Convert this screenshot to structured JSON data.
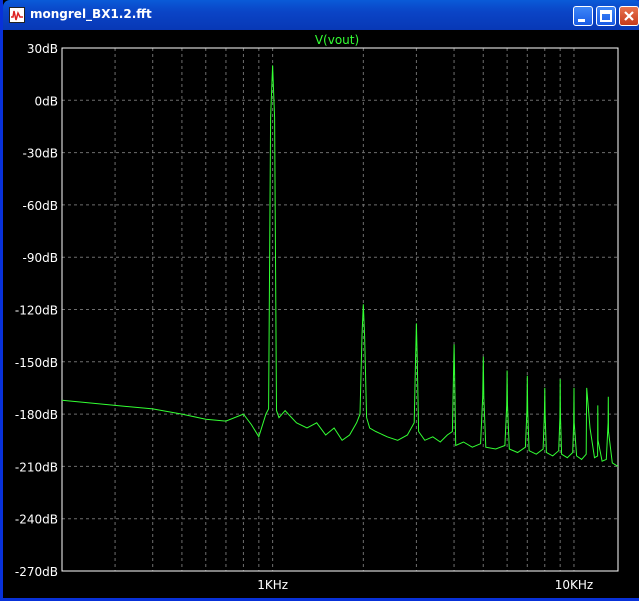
{
  "window": {
    "title": "mongrel_BX1.2.fft",
    "buttons": [
      "minimize",
      "maximize",
      "close"
    ],
    "icon": "waveform-icon"
  },
  "plot": {
    "trace_label": "V(vout)",
    "colors": {
      "background": "#000000",
      "trace": "#33ff33",
      "grid": "#6e6e6e",
      "axis_text": "#ffffff",
      "title_bar": "#0a44c6"
    }
  },
  "chart_data": {
    "type": "line",
    "title": "V(vout)",
    "xlabel": "",
    "ylabel": "",
    "x_scale": "log",
    "xlim_hz": [
      200,
      14000
    ],
    "ylim": [
      -270,
      30
    ],
    "y_ticks": [
      "30dB",
      "0dB",
      "-30dB",
      "-60dB",
      "-90dB",
      "-120dB",
      "-150dB",
      "-180dB",
      "-210dB",
      "-240dB",
      "-270dB"
    ],
    "x_ticks": [
      "1KHz",
      "10KHz"
    ],
    "grid": true,
    "series": [
      {
        "name": "V(vout)",
        "x_hz": [
          200,
          300,
          400,
          500,
          600,
          700,
          800,
          850,
          900,
          950,
          970,
          985,
          1000,
          1015,
          1030,
          1050,
          1100,
          1200,
          1300,
          1400,
          1500,
          1600,
          1700,
          1800,
          1900,
          1950,
          1980,
          2000,
          2020,
          2050,
          2100,
          2200,
          2400,
          2600,
          2800,
          2950,
          2980,
          3000,
          3020,
          3050,
          3200,
          3400,
          3600,
          3800,
          3950,
          3980,
          4000,
          4020,
          4050,
          4300,
          4600,
          4900,
          4980,
          5000,
          5020,
          5100,
          5500,
          5900,
          5980,
          6000,
          6020,
          6100,
          6500,
          6900,
          6980,
          7000,
          7020,
          7100,
          7500,
          7900,
          7980,
          8000,
          8020,
          8100,
          8500,
          8900,
          8980,
          9000,
          9020,
          9100,
          9500,
          9900,
          9980,
          10000,
          10020,
          10200,
          10600,
          10980,
          11000,
          11020,
          11300,
          11700,
          11980,
          12000,
          12020,
          12400,
          12800,
          12980,
          13000,
          13020,
          13400,
          14000
        ],
        "y_db": [
          -172,
          -175,
          -177,
          -180,
          -183,
          -184,
          -180,
          -186,
          -193,
          -180,
          -177,
          -10,
          20,
          -10,
          -178,
          -182,
          -178,
          -185,
          -188,
          -185,
          -192,
          -188,
          -195,
          -192,
          -185,
          -180,
          -135,
          -117,
          -135,
          -182,
          -188,
          -190,
          -193,
          -195,
          -192,
          -185,
          -150,
          -128,
          -150,
          -190,
          -195,
          -193,
          -196,
          -192,
          -190,
          -160,
          -140,
          -160,
          -198,
          -196,
          -199,
          -197,
          -170,
          -147,
          -170,
          -199,
          -200,
          -198,
          -175,
          -155,
          -175,
          -200,
          -202,
          -199,
          -178,
          -158,
          -178,
          -201,
          -203,
          -200,
          -180,
          -165,
          -180,
          -202,
          -204,
          -201,
          -182,
          -160,
          -182,
          -203,
          -205,
          -202,
          -185,
          -165,
          -185,
          -204,
          -206,
          -203,
          -185,
          -165,
          -188,
          -205,
          -204,
          -175,
          -195,
          -207,
          -206,
          -185,
          -170,
          -190,
          -208,
          -210
        ]
      }
    ]
  }
}
